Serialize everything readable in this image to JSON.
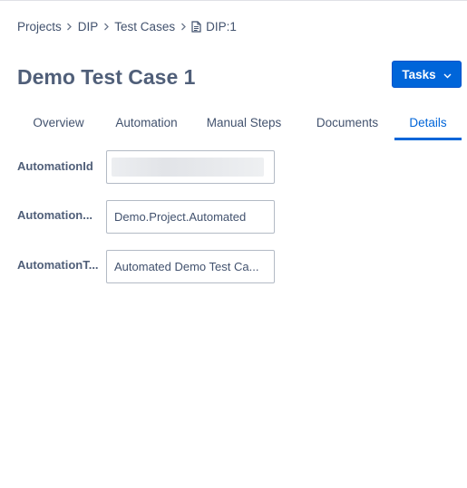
{
  "breadcrumb": {
    "items": [
      "Projects",
      "DIP",
      "Test Cases"
    ],
    "current": "DIP:1",
    "current_icon": "document-icon"
  },
  "page": {
    "title": "Demo Test Case 1"
  },
  "actions": {
    "tasks_label": "Tasks",
    "tasks_icon": "chevron-down-icon"
  },
  "tabs": [
    {
      "label": "Overview",
      "active": false
    },
    {
      "label": "Automation",
      "active": false
    },
    {
      "label": "Manual Steps",
      "active": false
    },
    {
      "label": "Documents",
      "active": false
    },
    {
      "label": "Details",
      "active": true
    }
  ],
  "fields": [
    {
      "label": "AutomationId",
      "value": "",
      "value_redacted": true
    },
    {
      "label": "Automation...",
      "value": "Demo.Project.Automated"
    },
    {
      "label": "AutomationT...",
      "value": "Automated Demo Test Ca..."
    }
  ],
  "colors": {
    "accent": "#0065d9",
    "text": "#42526e",
    "title": "#505f79",
    "border": "#b3bac5"
  }
}
